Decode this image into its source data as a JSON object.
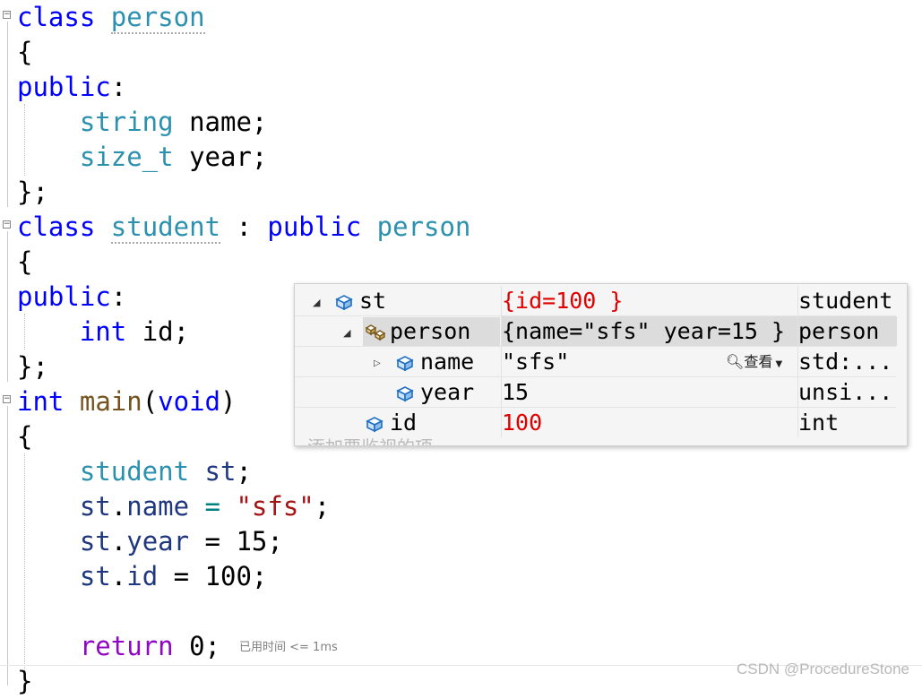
{
  "code": {
    "l1": {
      "kw": "class",
      "name": "person"
    },
    "brace_open": "{",
    "brace_close": "};",
    "public": "public",
    "colon": ":",
    "l4": {
      "type": "string",
      "rest": " name;"
    },
    "l5": {
      "type": "size_t",
      "rest": " year;"
    },
    "l7": {
      "kw": "class",
      "name": "student",
      "sep": " : ",
      "kw2": "public",
      "base": "person"
    },
    "l10": {
      "type": "int",
      "rest": " id;"
    },
    "l12": {
      "kw": "int",
      "fn": "main",
      "p1": "(",
      "arg": "void",
      "p2": ")"
    },
    "l14": {
      "type": "student",
      "var": "st",
      "semi": ";"
    },
    "l15": {
      "var": "st",
      "dot": ".",
      "field": "name",
      "eq": " = ",
      "str": "\"sfs\"",
      "semi": ";"
    },
    "l16": {
      "var": "st",
      "dot": ".",
      "field": "year",
      "rest": " = 15;"
    },
    "l17": {
      "var": "st",
      "dot": ".",
      "field": "id",
      "rest": " = 100;"
    },
    "l19": {
      "kw": "return",
      "rest": " 0;"
    },
    "l20": "}",
    "perf_tip": "已用时间 <= 1ms"
  },
  "datatip": {
    "rows": [
      {
        "name": "st",
        "value": "{id=100 }",
        "type": "student"
      },
      {
        "name": "person",
        "value": "{name=\"sfs\" year=15 }",
        "type": "person"
      },
      {
        "name": "name",
        "value": "\"sfs\"",
        "type": "std:..."
      },
      {
        "name": "year",
        "value": "15",
        "type": "unsi..."
      },
      {
        "name": "id",
        "value": "100",
        "type": "int"
      }
    ],
    "view_button": "查看",
    "add_watch": "添加要监视的项"
  },
  "watermark": "CSDN @ProcedureStone",
  "colors": {
    "keyword": "#0000ff",
    "type": "#2b91af",
    "changed": "#e00000"
  }
}
